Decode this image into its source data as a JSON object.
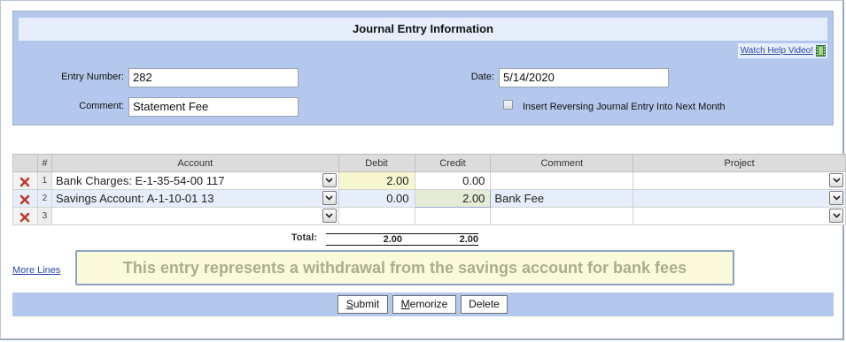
{
  "panel": {
    "title": "Journal Entry Information",
    "help_link": "Watch Help Video!"
  },
  "form": {
    "entry_number_label": "Entry Number:",
    "entry_number": "282",
    "comment_label": "Comment:",
    "comment": "Statement Fee",
    "date_label": "Date:",
    "date": "5/14/2020",
    "reversing_label": "Insert Reversing Journal Entry Into Next Month",
    "reversing_checked": false
  },
  "grid": {
    "headers": {
      "num": "#",
      "account": "Account",
      "debit": "Debit",
      "credit": "Credit",
      "comment": "Comment",
      "project": "Project"
    },
    "rows": [
      {
        "num": "1",
        "account": "Bank Charges: E-1-35-54-00 117",
        "debit": "2.00",
        "credit": "0.00",
        "comment": "",
        "project": ""
      },
      {
        "num": "2",
        "account": "Savings Account: A-1-10-01 13",
        "debit": "0.00",
        "credit": "2.00",
        "comment": "Bank Fee",
        "project": ""
      },
      {
        "num": "3",
        "account": "",
        "debit": "",
        "credit": "",
        "comment": "",
        "project": ""
      }
    ],
    "total_label": "Total:",
    "total_debit": "2.00",
    "total_credit": "2.00"
  },
  "more_lines": "More Lines",
  "note": "This entry represents a withdrawal from the savings account for bank fees",
  "buttons": {
    "submit_first": "S",
    "submit_rest": "ubmit",
    "memorize_first": "M",
    "memorize_rest": "emorize",
    "delete": "Delete"
  },
  "colors": {
    "panel_bg": "#b3c8ec",
    "title_bg": "#e6eefb",
    "delete_icon": "#c0392b"
  },
  "icons": {
    "delete": "red-x-icon",
    "dropdown": "chevron-down-icon",
    "video": "film-strip-icon"
  }
}
